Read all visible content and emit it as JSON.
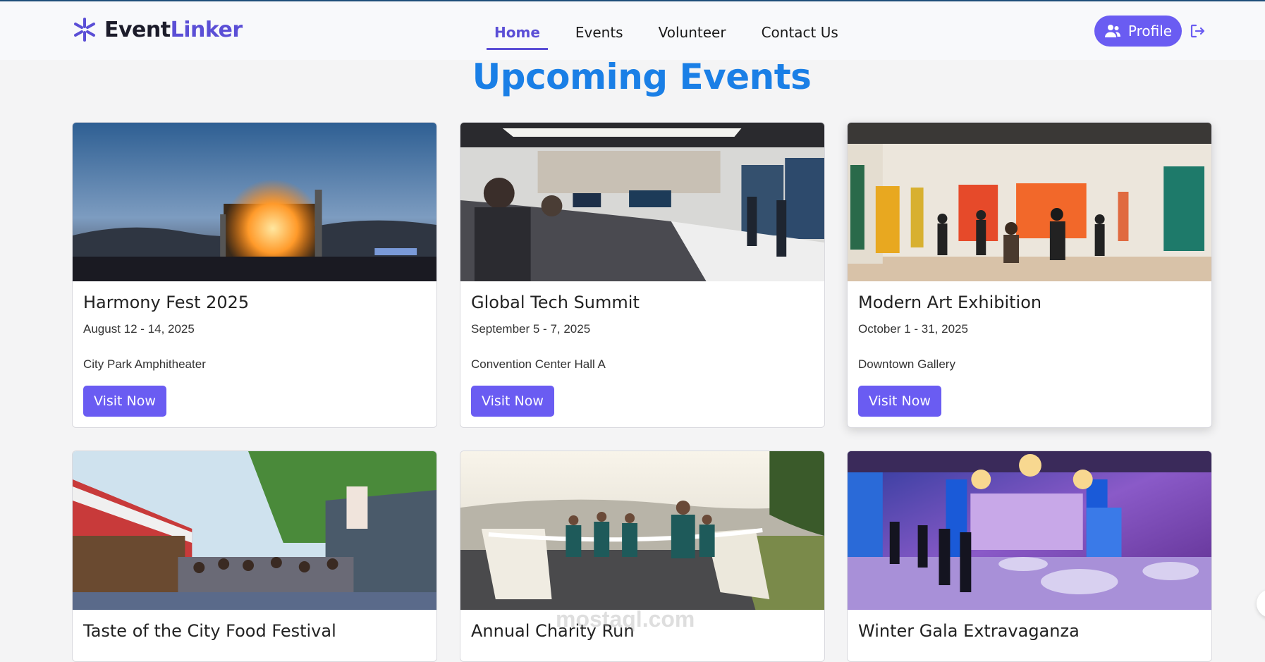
{
  "brand": {
    "name_part1": "Event",
    "name_part2": "Linker"
  },
  "nav": {
    "items": [
      {
        "label": "Home",
        "active": true
      },
      {
        "label": "Events",
        "active": false
      },
      {
        "label": "Volunteer",
        "active": false
      },
      {
        "label": "Contact Us",
        "active": false
      }
    ]
  },
  "header": {
    "profile_label": "Profile"
  },
  "main": {
    "title": "Upcoming Events",
    "events": [
      {
        "title": "Harmony Fest 2025",
        "date": "August 12 - 14, 2025",
        "venue": "City Park Amphitheater",
        "button": "Visit Now"
      },
      {
        "title": "Global Tech Summit",
        "date": "September 5 - 7, 2025",
        "venue": "Convention Center Hall A",
        "button": "Visit Now"
      },
      {
        "title": "Modern Art Exhibition",
        "date": "October 1 - 31, 2025",
        "venue": "Downtown Gallery",
        "button": "Visit Now"
      },
      {
        "title": "Taste of the City Food Festival"
      },
      {
        "title": "Annual Charity Run"
      },
      {
        "title": "Winter Gala Extravaganza"
      }
    ]
  },
  "watermark": "mostaql.com",
  "colors": {
    "accent": "#6a5cf2",
    "heading": "#1a7fe6",
    "brand_dark": "#1c1c2a"
  }
}
